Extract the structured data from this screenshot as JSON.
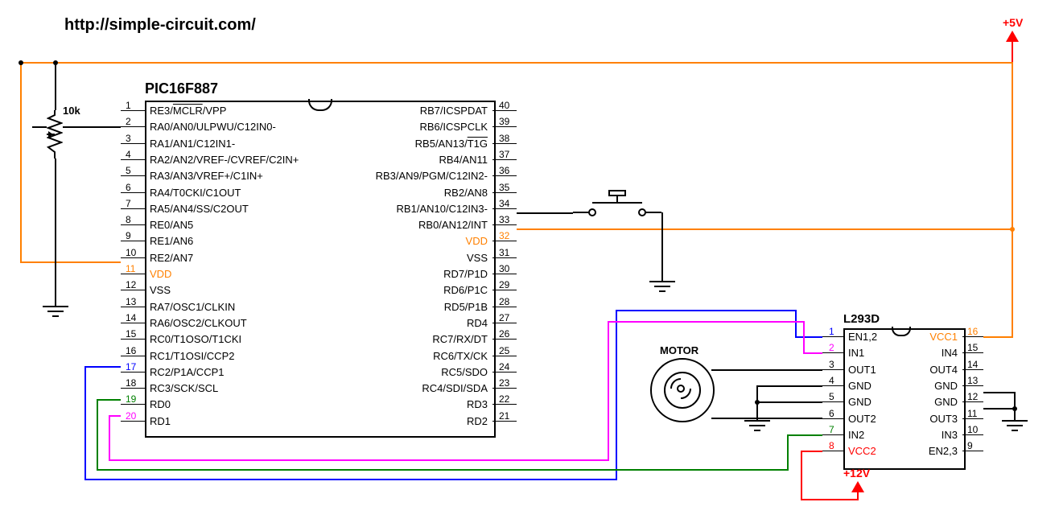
{
  "url": "http://simple-circuit.com/",
  "power": {
    "p5v": "+5V",
    "p12v": "+12V"
  },
  "resistor": {
    "value": "10k"
  },
  "motor_label": "MOTOR",
  "pic": {
    "name": "PIC16F887",
    "left_pins": [
      {
        "num": "1",
        "label": "RE3/MCLR/VPP",
        "mclr": true
      },
      {
        "num": "2",
        "label": "RA0/AN0/ULPWU/C12IN0-"
      },
      {
        "num": "3",
        "label": "RA1/AN1/C12IN1-"
      },
      {
        "num": "4",
        "label": "RA2/AN2/VREF-/CVREF/C2IN+"
      },
      {
        "num": "5",
        "label": "RA3/AN3/VREF+/C1IN+"
      },
      {
        "num": "6",
        "label": "RA4/T0CKI/C1OUT"
      },
      {
        "num": "7",
        "label": "RA5/AN4/SS/C2OUT"
      },
      {
        "num": "8",
        "label": "RE0/AN5"
      },
      {
        "num": "9",
        "label": "RE1/AN6"
      },
      {
        "num": "10",
        "label": "RE2/AN7"
      },
      {
        "num": "11",
        "label": "VDD",
        "vdd": true
      },
      {
        "num": "12",
        "label": "VSS"
      },
      {
        "num": "13",
        "label": "RA7/OSC1/CLKIN"
      },
      {
        "num": "14",
        "label": "RA6/OSC2/CLKOUT"
      },
      {
        "num": "15",
        "label": "RC0/T1OSO/T1CKI"
      },
      {
        "num": "16",
        "label": "RC1/T1OSI/CCP2"
      },
      {
        "num": "17",
        "label": "RC2/P1A/CCP1"
      },
      {
        "num": "18",
        "label": "RC3/SCK/SCL"
      },
      {
        "num": "19",
        "label": "RD0"
      },
      {
        "num": "20",
        "label": "RD1"
      }
    ],
    "right_pins": [
      {
        "num": "40",
        "label": "RB7/ICSPDAT"
      },
      {
        "num": "39",
        "label": "RB6/ICSPCLK"
      },
      {
        "num": "38",
        "label": "RB5/AN13/T1G",
        "t1g": true
      },
      {
        "num": "37",
        "label": "RB4/AN11"
      },
      {
        "num": "36",
        "label": "RB3/AN9/PGM/C12IN2-"
      },
      {
        "num": "35",
        "label": "RB2/AN8"
      },
      {
        "num": "34",
        "label": "RB1/AN10/C12IN3-"
      },
      {
        "num": "33",
        "label": "RB0/AN12/INT"
      },
      {
        "num": "32",
        "label": "VDD",
        "vdd": true
      },
      {
        "num": "31",
        "label": "VSS"
      },
      {
        "num": "30",
        "label": "RD7/P1D"
      },
      {
        "num": "29",
        "label": "RD6/P1C"
      },
      {
        "num": "28",
        "label": "RD5/P1B"
      },
      {
        "num": "27",
        "label": "RD4"
      },
      {
        "num": "26",
        "label": "RC7/RX/DT"
      },
      {
        "num": "25",
        "label": "RC6/TX/CK"
      },
      {
        "num": "24",
        "label": "RC5/SDO"
      },
      {
        "num": "23",
        "label": "RC4/SDI/SDA"
      },
      {
        "num": "22",
        "label": "RD3"
      },
      {
        "num": "21",
        "label": "RD2"
      }
    ]
  },
  "l293d": {
    "name": "L293D",
    "left_pins": [
      {
        "num": "1",
        "label": "EN1,2"
      },
      {
        "num": "2",
        "label": "IN1"
      },
      {
        "num": "3",
        "label": "OUT1"
      },
      {
        "num": "4",
        "label": "GND"
      },
      {
        "num": "5",
        "label": "GND"
      },
      {
        "num": "6",
        "label": "OUT2"
      },
      {
        "num": "7",
        "label": "IN2"
      },
      {
        "num": "8",
        "label": "VCC2",
        "vcc": true
      }
    ],
    "right_pins": [
      {
        "num": "16",
        "label": "VCC1",
        "vcc": true
      },
      {
        "num": "15",
        "label": "IN4"
      },
      {
        "num": "14",
        "label": "OUT4"
      },
      {
        "num": "13",
        "label": "GND"
      },
      {
        "num": "12",
        "label": "GND"
      },
      {
        "num": "11",
        "label": "OUT3"
      },
      {
        "num": "10",
        "label": "IN3"
      },
      {
        "num": "9",
        "label": "EN2,3"
      }
    ]
  }
}
